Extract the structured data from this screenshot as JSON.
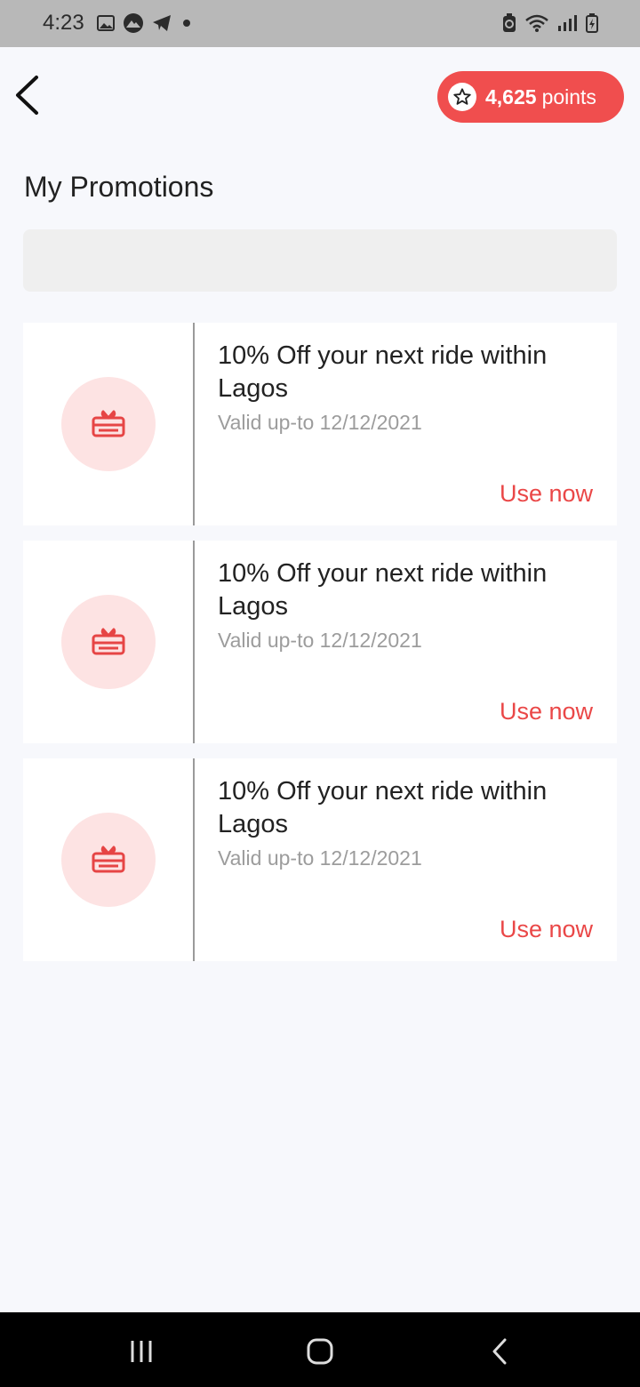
{
  "status_bar": {
    "time": "4:23",
    "left_icons": [
      "image-icon",
      "mountain-icon",
      "telegram-icon",
      "dot-icon"
    ],
    "right_icons": [
      "battery-saver-icon",
      "wifi-icon",
      "signal-icon",
      "battery-icon"
    ]
  },
  "header": {
    "points_value": "4,625",
    "points_unit": "points"
  },
  "page": {
    "title": "My Promotions",
    "search_placeholder": ""
  },
  "promotions": [
    {
      "title": "10% Off your next ride within Lagos",
      "valid": "Valid up-to 12/12/2021",
      "action": "Use now"
    },
    {
      "title": "10% Off your next ride within Lagos",
      "valid": "Valid up-to 12/12/2021",
      "action": "Use now"
    },
    {
      "title": "10% Off your next ride within Lagos",
      "valid": "Valid up-to 12/12/2021",
      "action": "Use now"
    }
  ],
  "colors": {
    "accent": "#f04e4e",
    "icon_bg": "#fde3e3",
    "muted_text": "#9c9c9c"
  },
  "nav_bar": [
    "recents-icon",
    "home-icon",
    "back-icon"
  ]
}
